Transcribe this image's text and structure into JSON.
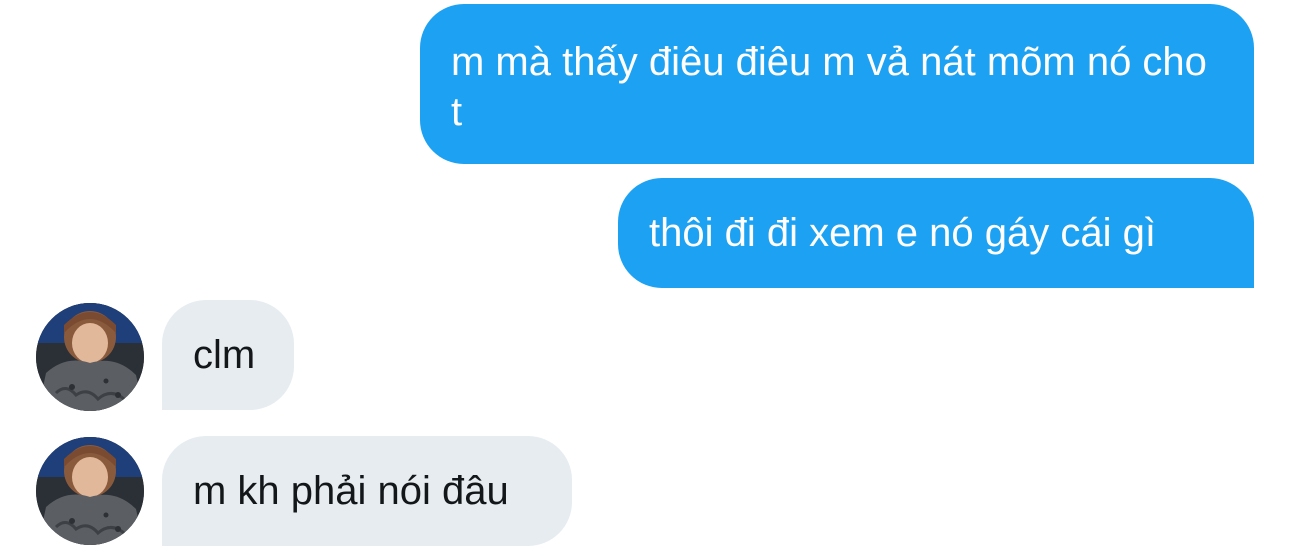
{
  "conversation": {
    "messages": [
      {
        "direction": "sent",
        "text": "m mà thấy điêu điêu m vả nát mõm nó cho t"
      },
      {
        "direction": "sent",
        "text": "thôi đi đi xem e nó gáy cái gì"
      },
      {
        "direction": "received",
        "text": "clm"
      },
      {
        "direction": "received",
        "text": "m kh phải nói đâu"
      }
    ]
  },
  "colors": {
    "sent_bubble": "#1da1f2",
    "received_bubble": "#e6ecf0",
    "sent_text": "#ffffff",
    "received_text": "#14171a"
  }
}
